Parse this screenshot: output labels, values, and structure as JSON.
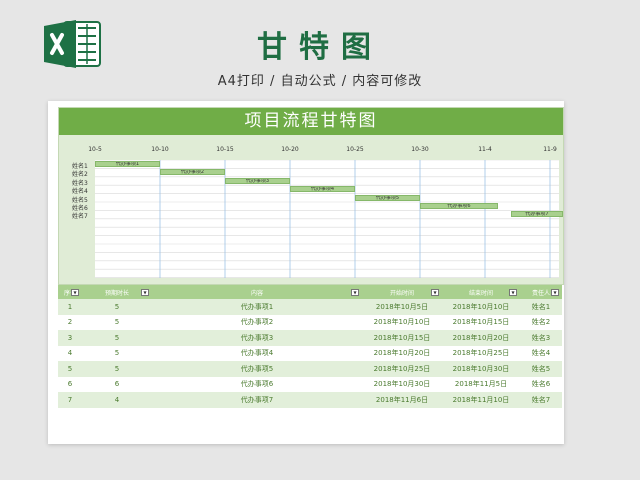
{
  "header": {
    "title": "甘特图",
    "subtitle": "A4打印 / 自动公式 / 内容可修改"
  },
  "chart": {
    "title": "项目流程甘特图",
    "dates": [
      "10-5",
      "10-10",
      "10-15",
      "10-20",
      "10-25",
      "10-30",
      "11-4",
      "11-9"
    ],
    "names": [
      "姓名1",
      "姓名2",
      "姓名3",
      "姓名4",
      "姓名5",
      "姓名6",
      "姓名7"
    ],
    "tasks": [
      {
        "label": "代办事项1",
        "start": 0,
        "duration": 5
      },
      {
        "label": "代办事项2",
        "start": 5,
        "duration": 5
      },
      {
        "label": "代办事项3",
        "start": 10,
        "duration": 5
      },
      {
        "label": "代办事项4",
        "start": 15,
        "duration": 5
      },
      {
        "label": "代办事项5",
        "start": 20,
        "duration": 5
      },
      {
        "label": "代办事项6",
        "start": 25,
        "duration": 6
      },
      {
        "label": "代办事项7",
        "start": 32,
        "duration": 4
      }
    ]
  },
  "table": {
    "columns": [
      "序号",
      "预期时长",
      "内容",
      "开始时间",
      "结束时间",
      "责任人"
    ],
    "rows": [
      [
        "1",
        "5",
        "代办事项1",
        "2018年10月5日",
        "2018年10月10日",
        "姓名1"
      ],
      [
        "2",
        "5",
        "代办事项2",
        "2018年10月10日",
        "2018年10月15日",
        "姓名2"
      ],
      [
        "3",
        "5",
        "代办事项3",
        "2018年10月15日",
        "2018年10月20日",
        "姓名3"
      ],
      [
        "4",
        "5",
        "代办事项4",
        "2018年10月20日",
        "2018年10月25日",
        "姓名4"
      ],
      [
        "5",
        "5",
        "代办事项5",
        "2018年10月25日",
        "2018年10月30日",
        "姓名5"
      ],
      [
        "6",
        "6",
        "代办事项6",
        "2018年10月30日",
        "2018年11月5日",
        "姓名6"
      ],
      [
        "7",
        "4",
        "代办事项7",
        "2018年11月6日",
        "2018年11月10日",
        "姓名7"
      ]
    ]
  },
  "colors": {
    "accent": "#70ad47",
    "title": "#1f6e43",
    "bar": "#a9d08e"
  }
}
